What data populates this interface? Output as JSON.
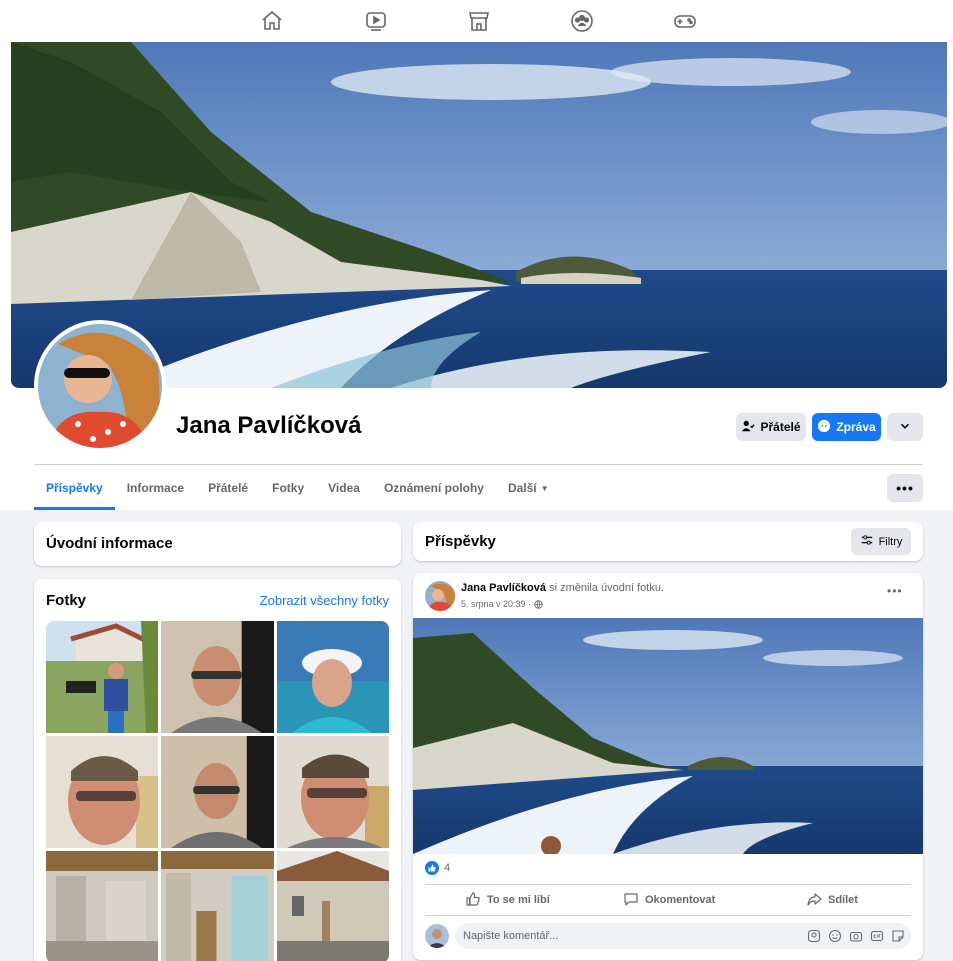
{
  "nav": {
    "icons": [
      "home-icon",
      "watch-icon",
      "marketplace-icon",
      "groups-icon",
      "gaming-icon"
    ]
  },
  "profile": {
    "name": "Jana Pavlíčková",
    "friends_button": "Přátelé",
    "message_button": "Zpráva"
  },
  "tabs": [
    {
      "label": "Příspěvky",
      "active": true
    },
    {
      "label": "Informace"
    },
    {
      "label": "Přátelé"
    },
    {
      "label": "Fotky"
    },
    {
      "label": "Videa"
    },
    {
      "label": "Oznámení polohy"
    },
    {
      "label": "Další"
    }
  ],
  "intro": {
    "title": "Úvodní informace"
  },
  "photos": {
    "title": "Fotky",
    "see_all": "Zobrazit všechny fotky"
  },
  "posts_header": {
    "title": "Příspěvky",
    "filters": "Filtry"
  },
  "post": {
    "author": "Jana Pavlíčková",
    "action_text": "si změnila úvodní fotku.",
    "time": "5. srpna v 20:39 ·",
    "reactions_count": "4",
    "like": "To se mi líbí",
    "comment": "Okomentovat",
    "share": "Sdílet",
    "comment_placeholder": "Napište komentář..."
  },
  "colors": {
    "accent": "#1877f2",
    "background": "#f0f2f5"
  }
}
